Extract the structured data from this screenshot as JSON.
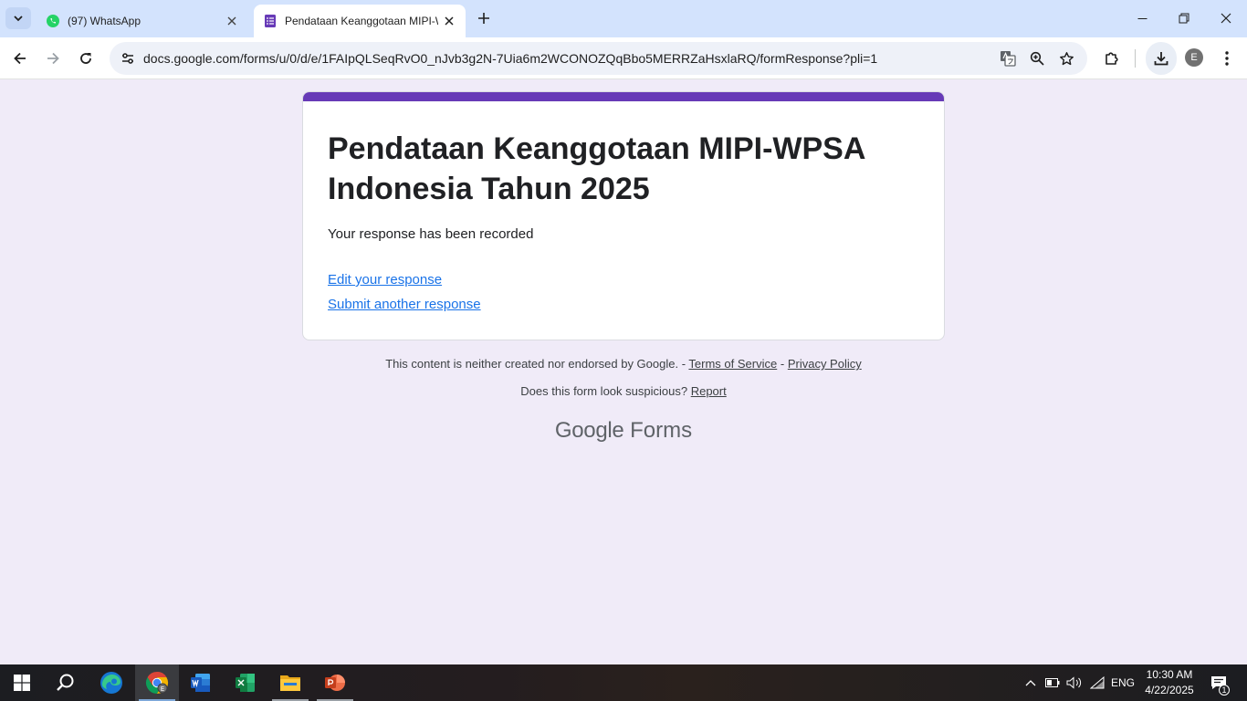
{
  "browser": {
    "tabs": [
      {
        "title": "(97) WhatsApp",
        "icon": "whatsapp-icon",
        "active": false
      },
      {
        "title": "Pendataan Keanggotaan MIPI-WPSA",
        "icon": "google-forms-icon",
        "active": true
      }
    ],
    "url": "docs.google.com/forms/u/0/d/e/1FAIpQLSeqRvO0_nJvb3g2N-7Uia6m2WCONOZQqBbo5MERRZaHsxlaRQ/formResponse?pli=1",
    "profile_initial": "E"
  },
  "form": {
    "title": "Pendataan Keanggotaan MIPI-WPSA Indonesia Tahun 2025",
    "confirmation": "Your response has been recorded",
    "edit_link": "Edit your response",
    "another_link": "Submit another response",
    "accent_color": "#673ab7"
  },
  "footer": {
    "disclaimer": "This content is neither created nor endorsed by Google. -",
    "terms": "Terms of Service",
    "separator": "-",
    "privacy": "Privacy Policy",
    "suspicious": "Does this form look suspicious?",
    "report": "Report",
    "brand_google": "Google",
    "brand_forms": "Forms"
  },
  "taskbar": {
    "apps": [
      "start-icon",
      "search-icon",
      "edge-icon",
      "chrome-icon",
      "word-icon",
      "excel-icon",
      "file-explorer-icon",
      "powerpoint-icon"
    ],
    "language": "ENG",
    "time": "10:30 AM",
    "date": "4/22/2025",
    "notification_count": "1"
  }
}
